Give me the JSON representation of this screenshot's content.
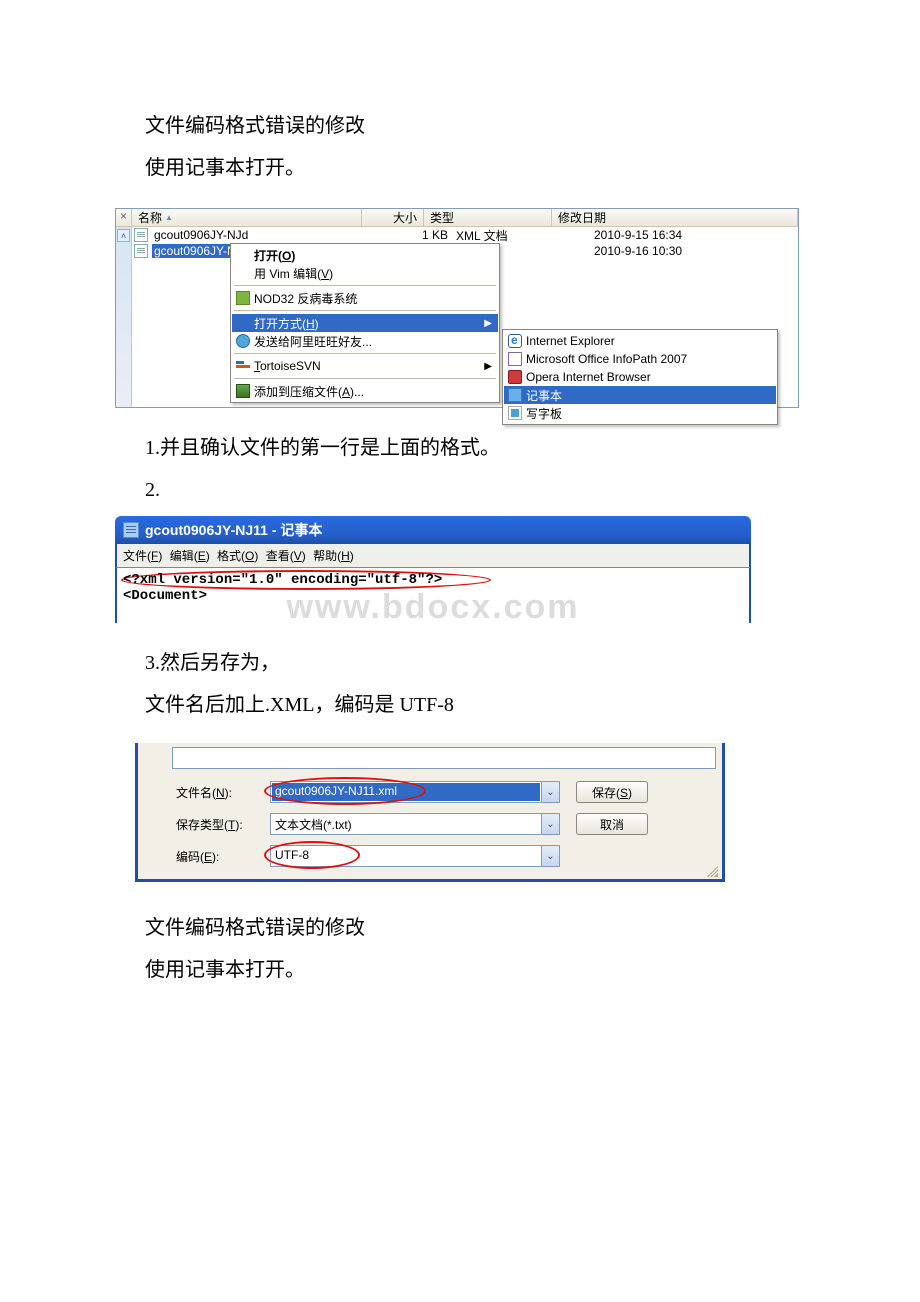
{
  "para": {
    "p1": "文件编码格式错误的修改",
    "p2": "使用记事本打开。",
    "p3_num": "1.",
    "p3_txt": "并且确认文件的第一行是上面的格式。",
    "p4": "2.",
    "p5_num": "3.",
    "p5_txt": "然后另存为，",
    "p6": "文件名后加上.XML，编码是 UTF-8",
    "p7": "文件编码格式错误的修改",
    "p8": "使用记事本打开。"
  },
  "explorer": {
    "close": "×",
    "headers": {
      "name": "名称",
      "size": "大小",
      "type": "类型",
      "date": "修改日期"
    },
    "rows": [
      {
        "name": "gcout0906JY-NJd",
        "size": "1 KB",
        "type": "XML 文档",
        "date": "2010-9-15 16:34"
      },
      {
        "name": "gcout0906JY-N",
        "size": "",
        "type": "",
        "date": "2010-9-16 10:30"
      }
    ],
    "menu1": {
      "open": "打开(O)",
      "vim": "用 Vim 编辑(V)",
      "nod32": "NOD32 反病毒系统",
      "openwith": "打开方式(H)",
      "aliww": "发送给阿里旺旺好友...",
      "tsvn": "TortoiseSVN",
      "addzip": "添加到压缩文件(A)..."
    },
    "menu2": {
      "ie": "Internet Explorer",
      "infopath": "Microsoft Office InfoPath 2007",
      "opera": "Opera Internet Browser",
      "notepad": "记事本",
      "wordpad": "写字板"
    }
  },
  "notepad": {
    "title": "gcout0906JY-NJ11 - 记事本",
    "menu": {
      "file": "文件(F)",
      "edit": "编辑(E)",
      "format": "格式(O)",
      "view": "查看(V)",
      "help": "帮助(H)"
    },
    "line1": "<?xml version=\"1.0\" encoding=\"utf-8\"?>",
    "line2": "<Document>",
    "watermark": "www.bdocx.com"
  },
  "saveas": {
    "filename_lbl": "文件名(N):",
    "filename_val": "gcout0906JY-NJ11.xml",
    "filetype_lbl": "保存类型(T):",
    "filetype_val": "文本文档(*.txt)",
    "encoding_lbl": "编码(E):",
    "encoding_val": "UTF-8",
    "save_btn": "保存(S)",
    "cancel_btn": "取消"
  }
}
